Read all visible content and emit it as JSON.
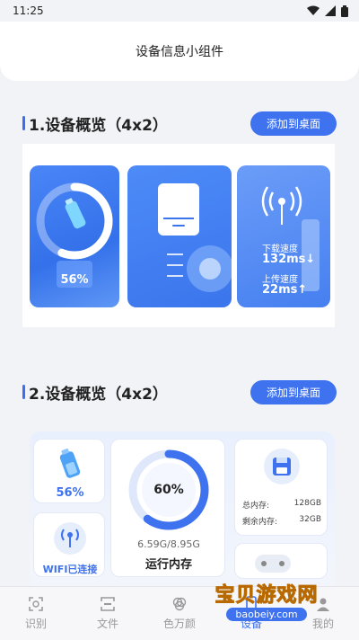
{
  "status_bar": {
    "time": "11:25"
  },
  "header": {
    "title": "设备信息小组件"
  },
  "sections": [
    {
      "title": "1.设备概览（4x2）",
      "button": "添加到桌面"
    },
    {
      "title": "2.设备概览（4x2）",
      "button": "添加到桌面"
    }
  ],
  "widget1": {
    "battery_percent": "56%",
    "battery_level": 0.56,
    "download_label": "下载速度",
    "download_value": "132ms↓",
    "upload_label": "上传速度",
    "upload_value": "22ms↑"
  },
  "widget2": {
    "battery_percent": "56%",
    "battery_level": 0.56,
    "wifi_status": "WIFI已连接",
    "memory_percent": "60%",
    "memory_level": 0.6,
    "memory_usage": "6.59G/8.95G",
    "memory_label": "运行内存",
    "storage_total_label": "总内存:",
    "storage_total_value": "128GB",
    "storage_free_label": "剩余内存:",
    "storage_free_value": "32GB"
  },
  "bottom_nav": [
    {
      "label": "识别",
      "icon": "scan-icon"
    },
    {
      "label": "文件",
      "icon": "file-icon"
    },
    {
      "label": "色万颜",
      "icon": "color-icon"
    },
    {
      "label": "设备",
      "icon": "device-icon"
    },
    {
      "label": "我的",
      "icon": "profile-icon"
    }
  ],
  "watermark": {
    "title": "宝贝游戏网",
    "url": "baobeiy.com"
  },
  "colors": {
    "accent": "#3e72ef",
    "card_blue": "#3b75ec",
    "background": "#f2f3f6"
  }
}
